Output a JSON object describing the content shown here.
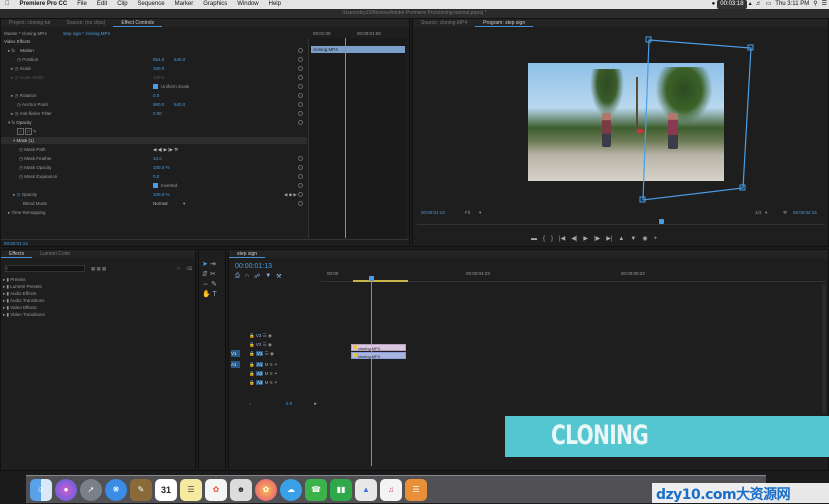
{
  "menubar": {
    "app": "Premiere Pro CC",
    "items": [
      "File",
      "Edit",
      "Clip",
      "Sequence",
      "Marker",
      "Graphics",
      "Window",
      "Help"
    ],
    "clock": "Thu 3:11 PM",
    "record_badge": "00:03:18"
  },
  "titlebar": "/Users/dzy10/Movies/Adobe Premiere Pro/cloning-tutorial.prproj *",
  "effect_controls": {
    "tabs": [
      "Project: cloning-tut",
      "Source: (no clips)",
      "Effect Controls"
    ],
    "active_tab": "Effect Controls",
    "master_label": "Master * cloning.MP4",
    "sequence_label": "step sign * cloning.MP4",
    "section": "Video Effects",
    "timecode_a": "00:01:00",
    "timecode_b": "00:00:01:00",
    "clip_name": "cloning.MP4",
    "rows": [
      {
        "label": "Motion",
        "value": ""
      },
      {
        "label": "Position",
        "value": "864.0",
        "value2": "540.0"
      },
      {
        "label": "Scale",
        "value": "100.0",
        "value2": ""
      },
      {
        "label": "Scale Width",
        "value": "100.0",
        "value2": ""
      },
      {
        "label": "",
        "value": "Uniform Scale",
        "value2": ""
      },
      {
        "label": "Rotation",
        "value": "0.0",
        "value2": ""
      },
      {
        "label": "Anchor Point",
        "value": "960.0",
        "value2": "540.0"
      },
      {
        "label": "Anti-flicker Filter",
        "value": "0.00",
        "value2": ""
      },
      {
        "label": "Opacity",
        "value": "",
        "value2": ""
      },
      {
        "label": "",
        "value": "",
        "value2": ""
      },
      {
        "label": "Mask (1)",
        "value": "",
        "value2": ""
      },
      {
        "label": "Mask Path",
        "value": "",
        "value2": ""
      },
      {
        "label": "Mask Feather",
        "value": "10.0",
        "value2": ""
      },
      {
        "label": "Mask Opacity",
        "value": "100.0 %",
        "value2": ""
      },
      {
        "label": "Mask Expansion",
        "value": "0.0",
        "value2": ""
      },
      {
        "label": "",
        "value": "Inverted",
        "value2": ""
      },
      {
        "label": "Opacity",
        "value": "100.0 %",
        "value2": ""
      },
      {
        "label": "Blend Mode",
        "value": "Normal",
        "value2": ""
      },
      {
        "label": "Time Remapping",
        "value": "",
        "value2": ""
      }
    ],
    "footer_time": "00:00:01:13"
  },
  "program": {
    "tabs": [
      "Source: cloning.MP4",
      "Program: step sign"
    ],
    "active_tab": "Program: step sign",
    "timecode": "00:00:01:13",
    "fit": "Fit",
    "ratio": "1/4",
    "duration": "00:00:02:15"
  },
  "effects": {
    "tabs": [
      "Effects",
      "Lumetri Color"
    ],
    "active_tab": "Effects",
    "items": [
      "Presets",
      "Lumetri Presets",
      "Audio Effects",
      "Audio Transitions",
      "Video Effects",
      "Video Transitions"
    ]
  },
  "timeline": {
    "tab": "step sign",
    "timecode": "00:00:01:13",
    "ruler": [
      "00:00",
      "00:00:04:23",
      "00:00:09:23"
    ],
    "tracks_video": [
      "V3",
      "V2",
      "V1"
    ],
    "tracks_audio": [
      "A1",
      "A2",
      "A3"
    ],
    "clips": [
      "cloning.MP4",
      "cloning.MP4"
    ],
    "master_value": "0.0"
  },
  "overlay": {
    "title": "CLONING",
    "color": "#53c6cf"
  },
  "watermark": "dzy10.com大资源网",
  "dock_icons": [
    "finder-icon",
    "siri-icon",
    "launchpad-icon",
    "safari-icon",
    "notes-icon",
    "calendar-icon",
    "reminders-icon",
    "photos-icon",
    "messages-icon",
    "facetime-icon",
    "numbers-icon",
    "keynote-icon",
    "music-icon",
    "books-icon",
    "appstore-icon",
    "settings-icon"
  ],
  "calendar_day": "31"
}
